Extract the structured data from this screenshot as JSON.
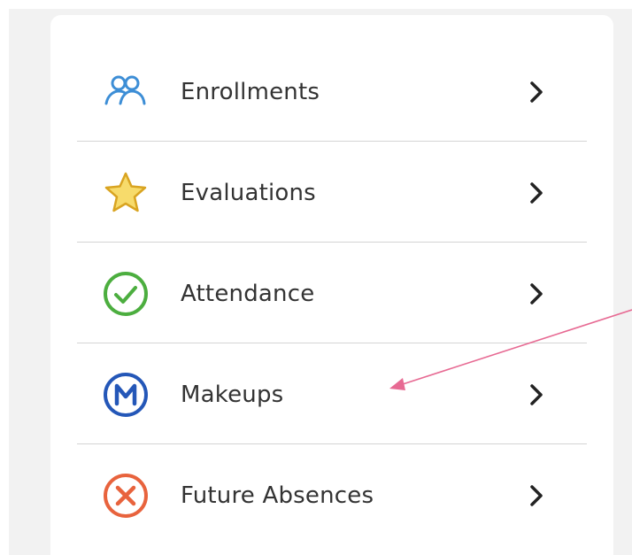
{
  "menu": {
    "items": [
      {
        "label": "Enrollments",
        "icon": "users-icon"
      },
      {
        "label": "Evaluations",
        "icon": "star-icon"
      },
      {
        "label": "Attendance",
        "icon": "check-circle-icon"
      },
      {
        "label": "Makeups",
        "icon": "makeup-m-icon"
      },
      {
        "label": "Future Absences",
        "icon": "x-circle-icon"
      }
    ]
  },
  "colors": {
    "users": "#3d8ed6",
    "star_fill": "#f7db6b",
    "star_stroke": "#d9a421",
    "check": "#4cae3f",
    "makeup": "#2457b8",
    "absence": "#e8633d",
    "annotation_arrow": "#e76a93"
  }
}
